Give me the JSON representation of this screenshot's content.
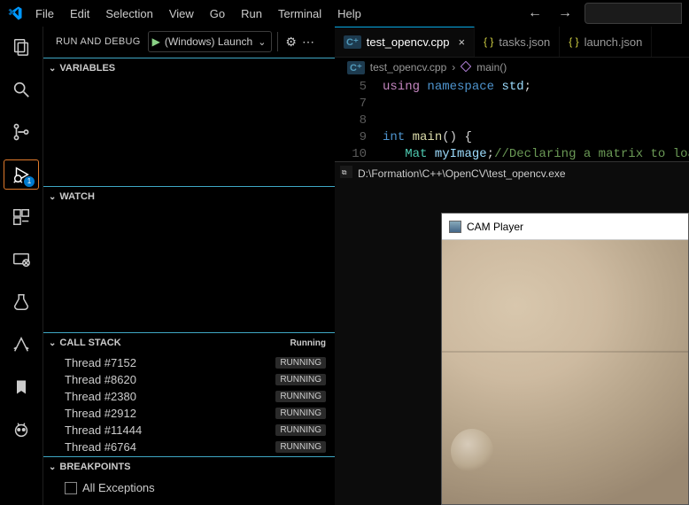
{
  "menu": [
    "File",
    "Edit",
    "Selection",
    "View",
    "Go",
    "Run",
    "Terminal",
    "Help"
  ],
  "activity": {
    "debug_badge": "1"
  },
  "sidebar": {
    "title": "RUN AND DEBUG",
    "config_name": "(Windows) Launch",
    "sections": {
      "variables": {
        "label": "VARIABLES"
      },
      "watch": {
        "label": "WATCH"
      },
      "callstack": {
        "label": "CALL STACK",
        "state": "Running",
        "threads": [
          {
            "name": "Thread #7152",
            "state": "RUNNING"
          },
          {
            "name": "Thread #8620",
            "state": "RUNNING"
          },
          {
            "name": "Thread #2380",
            "state": "RUNNING"
          },
          {
            "name": "Thread #2912",
            "state": "RUNNING"
          },
          {
            "name": "Thread #11444",
            "state": "RUNNING"
          },
          {
            "name": "Thread #6764",
            "state": "RUNNING"
          }
        ]
      },
      "breakpoints": {
        "label": "BREAKPOINTS",
        "items": [
          {
            "label": "All Exceptions",
            "checked": false
          }
        ]
      }
    }
  },
  "tabs": [
    {
      "label": "test_opencv.cpp",
      "icon": "cpp",
      "active": true,
      "dirty": false
    },
    {
      "label": "tasks.json",
      "icon": "json",
      "active": false,
      "dirty": false
    },
    {
      "label": "launch.json",
      "icon": "json",
      "active": false,
      "dirty": false
    }
  ],
  "breadcrumbs": {
    "file": "test_opencv.cpp",
    "symbol": "main()"
  },
  "code_lines": [
    {
      "n": "5",
      "html": "<span class='kw2'>using</span> <span class='kw'>namespace</span> <span class='id'>std</span><span class='pn'>;</span>"
    },
    {
      "n": "7",
      "html": ""
    },
    {
      "n": "8",
      "html": ""
    },
    {
      "n": "9",
      "html": "<span class='kw'>int</span> <span class='fn'>main</span><span class='pn'>() {</span>"
    },
    {
      "n": "10",
      "html": "   <span class='typ'>Mat</span> <span class='id'>myImage</span><span class='pn'>;</span><span class='cm'>//Declaring a matrix to load</span>"
    }
  ],
  "console": {
    "title": "D:\\Formation\\C++\\OpenCV\\test_opencv.exe"
  },
  "cam": {
    "title": "CAM Player"
  }
}
